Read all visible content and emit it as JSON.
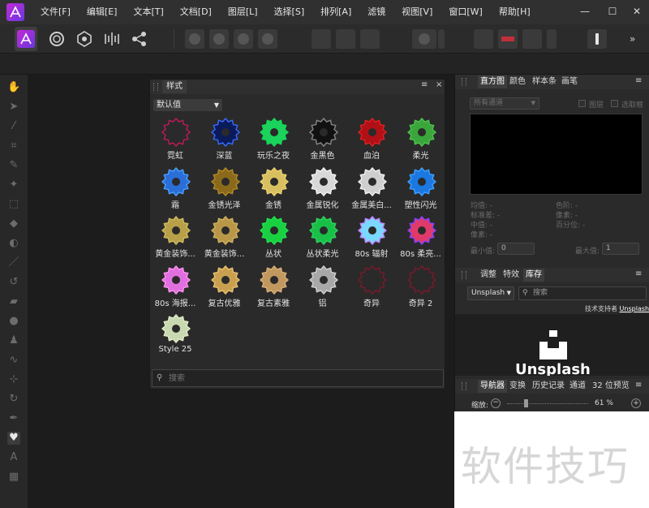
{
  "menubar": {
    "logo_icon": "affinity-photo-logo",
    "items": [
      "文件[F]",
      "编辑[E]",
      "文本[T]",
      "文档[D]",
      "图层[L]",
      "选择[S]",
      "排列[A]",
      "滤镜",
      "视图[V]",
      "窗口[W]",
      "帮助[H]"
    ],
    "window_controls": [
      "—",
      "☐",
      "✕"
    ]
  },
  "styles_panel": {
    "tab": "样式",
    "menu_glyph": "≡",
    "close_glyph": "×",
    "category": "默认值",
    "search_placeholder": "搜索",
    "styles": [
      {
        "label": "霓虹",
        "fill": "#2a2a2a",
        "stroke": "#c2185b"
      },
      {
        "label": "深蓝",
        "fill": "#0b1b5a",
        "stroke": "#3a6bff"
      },
      {
        "label": "玩乐之夜",
        "fill": "#19d35a",
        "stroke": "#19d35a"
      },
      {
        "label": "金黑色",
        "fill": "#111111",
        "stroke": "#888888"
      },
      {
        "label": "血泊",
        "fill": "#b01016",
        "stroke": "#e02020"
      },
      {
        "label": "柔光",
        "fill": "#3aa53a",
        "stroke": "#4fc04f"
      },
      {
        "label": "霜",
        "fill": "#2a6ed8",
        "stroke": "#4aa0ff"
      },
      {
        "label": "金锈光泽",
        "fill": "#8a6a1a",
        "stroke": "#b08a2a"
      },
      {
        "label": "金锈",
        "fill": "#d8c060",
        "stroke": "#e8d070"
      },
      {
        "label": "金属锐化",
        "fill": "#d8d8d8",
        "stroke": "#f0f0f0"
      },
      {
        "label": "金属美白...",
        "fill": "#cfcfcf",
        "stroke": "#f0f0f0"
      },
      {
        "label": "塑性闪光",
        "fill": "#1a78e0",
        "stroke": "#40a0ff"
      },
      {
        "label": "黄金装饰...",
        "fill": "#b8a048",
        "stroke": "#d0b860"
      },
      {
        "label": "黄金装饰...",
        "fill": "#b89848",
        "stroke": "#d0b060"
      },
      {
        "label": "丛状",
        "fill": "#18d040",
        "stroke": "#20e050"
      },
      {
        "label": "丛状柔光",
        "fill": "#18c048",
        "stroke": "#30d060"
      },
      {
        "label": "80s 辐射",
        "fill": "#7ad8ff",
        "stroke": "#c080ff"
      },
      {
        "label": "80s 柔亮...",
        "fill": "#e03a6a",
        "stroke": "#8040ff"
      },
      {
        "label": "80s 海报...",
        "fill": "#e070e0",
        "stroke": "#ff90f0"
      },
      {
        "label": "复古优雅",
        "fill": "#c8a050",
        "stroke": "#e8c070"
      },
      {
        "label": "复古素雅",
        "fill": "#c09860",
        "stroke": "#d8b078"
      },
      {
        "label": "铝",
        "fill": "#a8a8a8",
        "stroke": "#d0d0d0"
      },
      {
        "label": "奇异",
        "fill": "#2a2a2a",
        "stroke": "#7a1a2a"
      },
      {
        "label": "奇异 2",
        "fill": "#2a2a2a",
        "stroke": "#7a1a2a"
      },
      {
        "label": "Style 25",
        "fill": "#c8d8b0",
        "stroke": "#e0eac8"
      }
    ]
  },
  "histogram_panel": {
    "tabs": [
      "直方图",
      "颜色",
      "样本条",
      "画笔"
    ],
    "active_tab": "直方图",
    "channel_select": "所有通道",
    "layer_check": "图层",
    "marquee_check": "选取框",
    "stats_left": [
      "均值: -",
      "标准差: -",
      "中值: -",
      "像素: -"
    ],
    "stats_right": [
      "色阶: -",
      "像素: -",
      "百分位: -"
    ],
    "min_label": "最小值:",
    "min_value": "0",
    "max_label": "最大值:",
    "max_value": "1"
  },
  "library_panel": {
    "tabs": [
      "调整",
      "特效",
      "库存"
    ],
    "active_tab": "库存",
    "source_select": "Unsplash",
    "search_placeholder": "搜索",
    "powered_by": "技术支持者",
    "powered_link": "Unsplash",
    "brand_text": "Unsplash"
  },
  "navigator_panel": {
    "tabs": [
      "导航器",
      "变换",
      "历史记录",
      "通道",
      "32 位预览"
    ],
    "active_tab": "导航器",
    "zoom_label": "缩放:",
    "zoom_value": "61 %"
  },
  "watermark": "软件技巧"
}
